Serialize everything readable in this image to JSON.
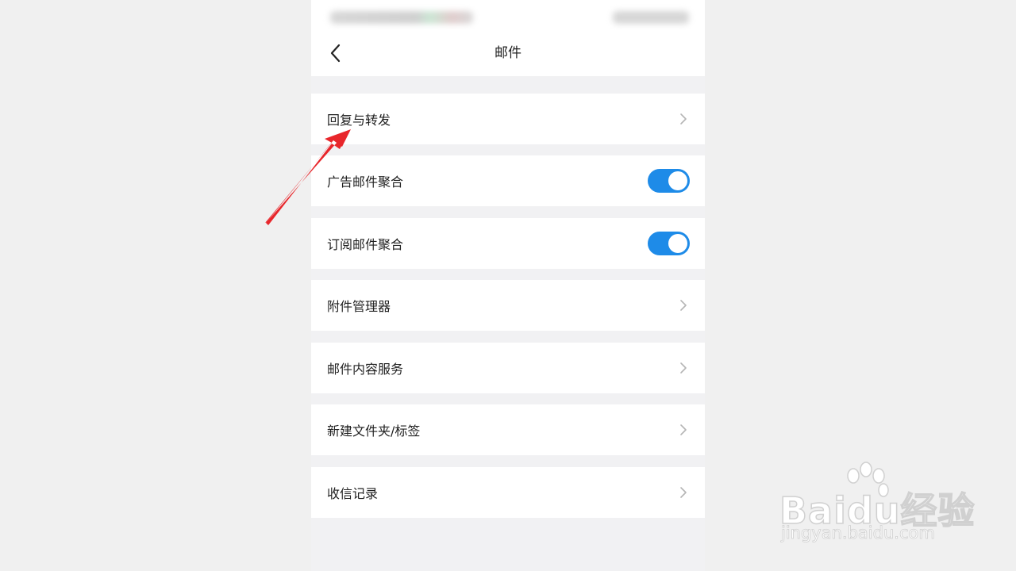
{
  "nav": {
    "title": "邮件"
  },
  "settings": [
    {
      "label": "回复与转发",
      "control": "chevron"
    },
    {
      "label": "广告邮件聚合",
      "control": "toggle",
      "on": true
    },
    {
      "label": "订阅邮件聚合",
      "control": "toggle",
      "on": true
    },
    {
      "label": "附件管理器",
      "control": "chevron"
    },
    {
      "label": "邮件内容服务",
      "control": "chevron"
    },
    {
      "label": "新建文件夹/标签",
      "control": "chevron"
    },
    {
      "label": "收信记录",
      "control": "chevron"
    }
  ],
  "icons": {
    "back": "chevron-left-icon",
    "row_arrow": "chevron-right-icon",
    "annotation": "red-arrow-icon"
  },
  "colors": {
    "toggle_on": "#1e8be8",
    "background": "#f1f1f3",
    "annotation_arrow": "#e8262b"
  },
  "watermark": {
    "logo": "Baidu经验",
    "url": "jingyan.baidu.com"
  }
}
